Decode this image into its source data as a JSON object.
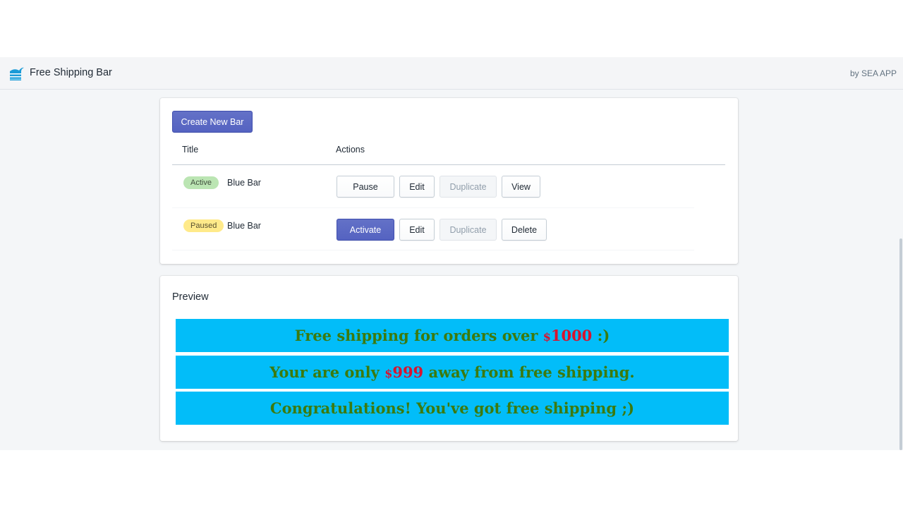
{
  "header": {
    "app_title": "Free Shipping Bar",
    "byline": "by SEA APP",
    "logo_icon": "wave-logo-icon"
  },
  "bars_card": {
    "create_button": "Create New Bar",
    "columns": [
      "Title",
      "Actions"
    ],
    "rows": [
      {
        "status": "Active",
        "name": "Blue Bar",
        "actions": [
          "Pause",
          "Edit",
          "Duplicate",
          "View"
        ]
      },
      {
        "status": "Paused",
        "name": "Blue Bar",
        "actions": [
          "Activate",
          "Edit",
          "Duplicate",
          "Delete"
        ]
      }
    ]
  },
  "preview": {
    "heading": "Preview",
    "banners": [
      {
        "before": "Free shipping for orders over ",
        "currency": "$",
        "amount": "1000",
        "after": " :)"
      },
      {
        "before": "Your are only ",
        "currency": "$",
        "amount": "999",
        "after": " away from free shipping."
      },
      {
        "before": "Congratulations! You've got free shipping ;)",
        "currency": "",
        "amount": "",
        "after": ""
      }
    ]
  },
  "colors": {
    "primary": "#5c6ac4",
    "banner_background": "#02bdf9",
    "banner_text": "#3c7a0e",
    "banner_amount": "#d7132f",
    "badge_active": "#bbe5b3",
    "badge_paused": "#ffea8a"
  }
}
